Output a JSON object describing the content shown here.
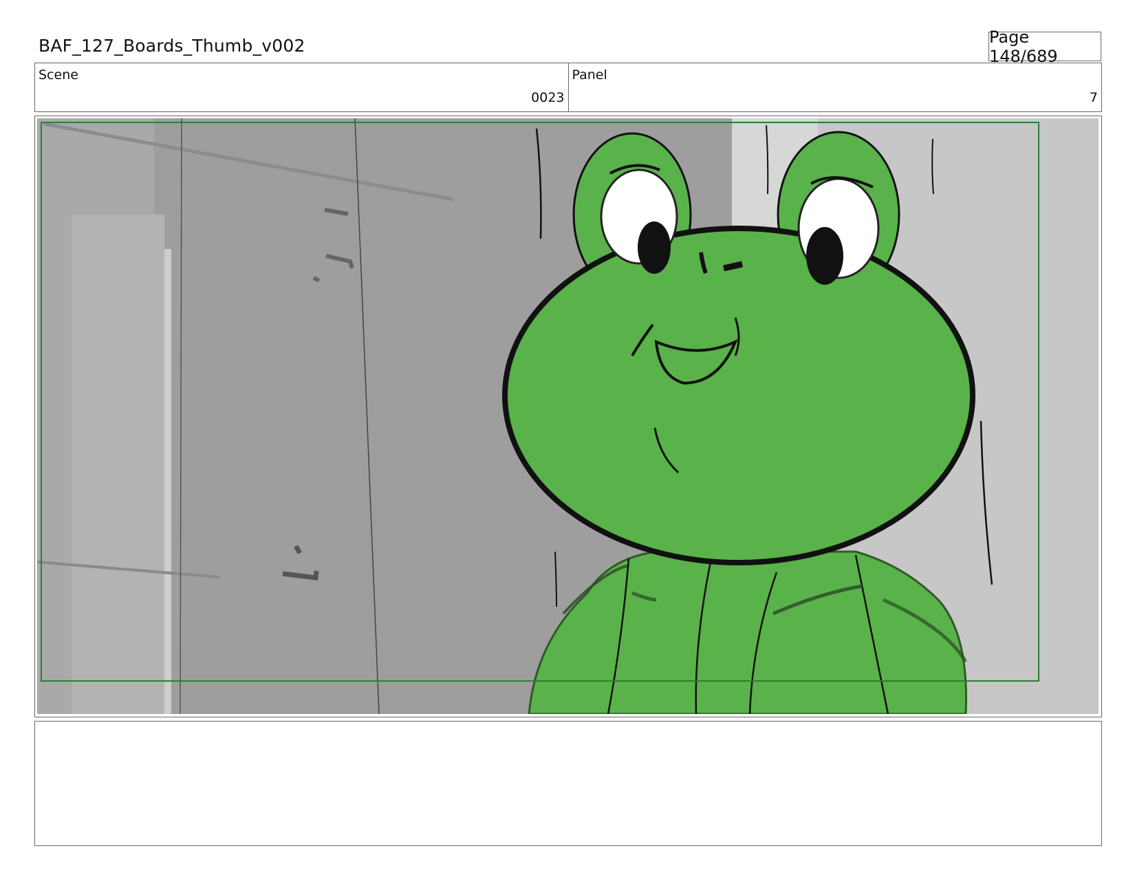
{
  "header": {
    "title": "BAF_127_Boards_Thumb_v002",
    "page": "Page 148/689"
  },
  "info": {
    "scene_label": "Scene",
    "scene_value": "0023",
    "panel_label": "Panel",
    "panel_value": "7"
  },
  "frame": {
    "safe_area_color": "#2e7d2e",
    "character_color": "#5ab24a",
    "background_colors": [
      "#9e9e9e",
      "#c6c6c6",
      "#d4d6d4"
    ]
  },
  "notes": {
    "text": ""
  }
}
